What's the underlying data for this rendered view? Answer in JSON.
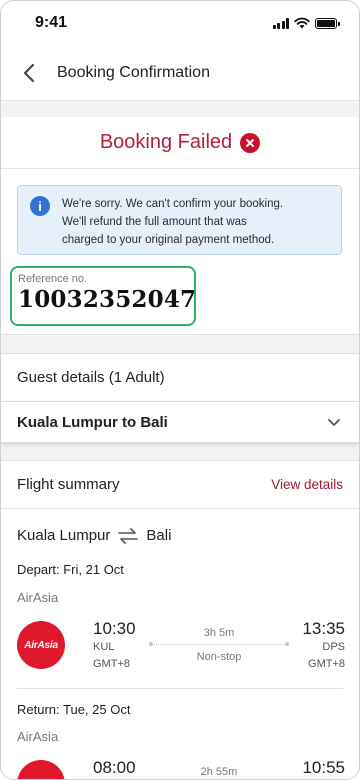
{
  "status_bar": {
    "time": "9:41"
  },
  "header": {
    "title": "Booking Confirmation"
  },
  "failure": {
    "title": "Booking Failed",
    "message_line1": "We're sorry. We can't confirm your booking.",
    "message_line2": "We'll refund the full amount that was",
    "message_line3": "charged to your original payment method.",
    "reference_label": "Reference no.",
    "reference_number": "10032352047"
  },
  "guest": {
    "label": "Guest details (1 Adult)"
  },
  "route": {
    "label": "Kuala Lumpur to Bali"
  },
  "summary": {
    "title": "Flight summary",
    "view_details": "View details",
    "origin_city": "Kuala Lumpur",
    "destination_city": "Bali",
    "depart": {
      "label": "Depart: Fri, 21 Oct",
      "airline": "AirAsia",
      "logo_text": "AirAsia",
      "dep_time": "10:30",
      "dep_code": "KUL",
      "dep_gmt": "GMT+8",
      "duration": "3h 5m",
      "stops": "Non-stop",
      "arr_time": "13:35",
      "arr_code": "DPS",
      "arr_gmt": "GMT+8"
    },
    "return": {
      "label": "Return: Tue, 25 Oct",
      "airline": "AirAsia",
      "dep_time": "08:00",
      "duration": "2h 55m",
      "arr_time": "10:55"
    }
  },
  "colors": {
    "brand": "#b3203a",
    "error": "#c8102e",
    "info_bg": "#e6f0fb",
    "highlight": "#2fb35e",
    "airline": "#e0182d"
  }
}
